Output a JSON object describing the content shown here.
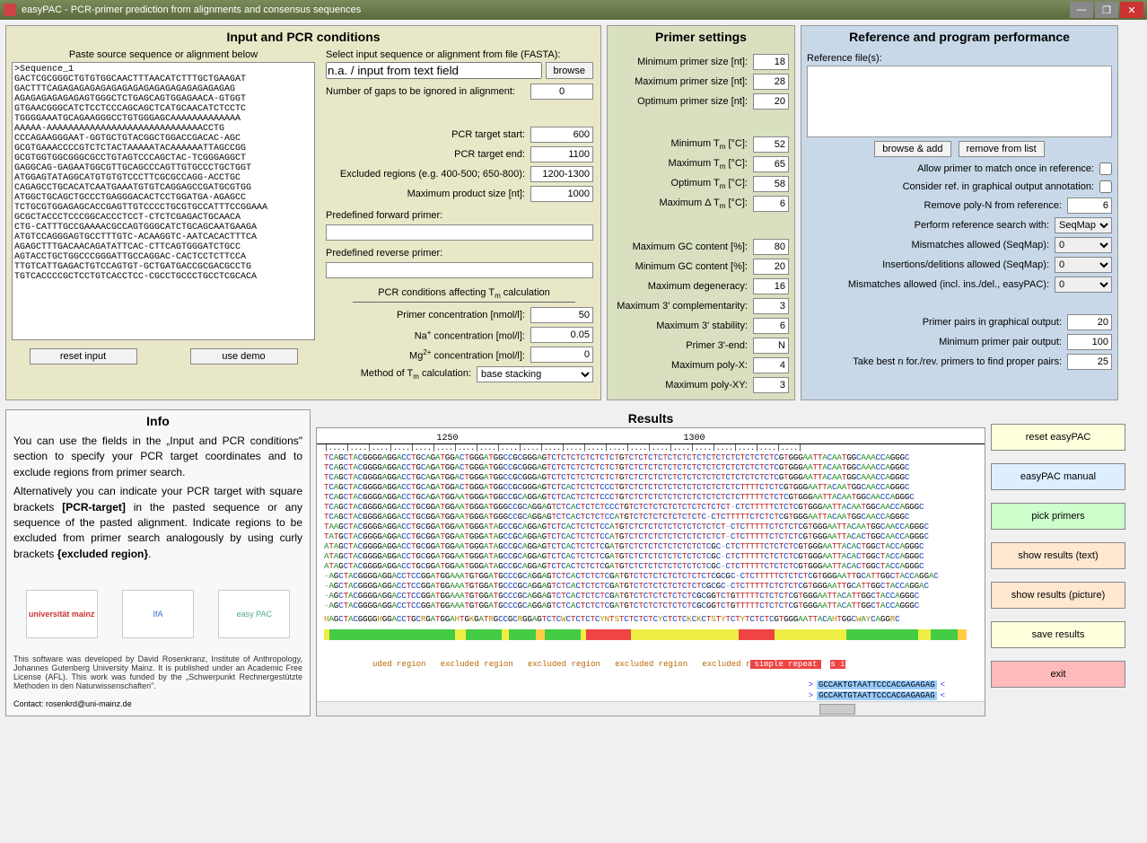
{
  "window": {
    "title": "easyPAC - PCR-primer prediction from alignments and consensus sequences"
  },
  "panels": {
    "input": {
      "title": "Input and PCR conditions"
    },
    "primer": {
      "title": "Primer settings"
    },
    "ref": {
      "title": "Reference and program performance"
    },
    "info": {
      "title": "Info"
    },
    "results": {
      "title": "Results"
    }
  },
  "input": {
    "paste_label": "Paste source sequence or alignment below",
    "sequence": ">Sequence_1\nGACTCGCGGGCTGTGTGGCAACTTTAACATCTTTGCTGAAGAT\nGACTTTCAGAGAGAGAGAGAGAGAGAGAGAGAGAGAGAGAG\nAGAGAGAGAGAGAGTGGGCTCTGAGCAGTGGAGAACA-GTGGT\nGTGAACGGGCATCTCCTCCCAGCAGCTCATGCAACATCTCCTC\nTGGGGAAATGCAGAAGGGCCTGTGGGAGCAAAAAAAAAAAAA\nAAAAA-AAAAAAAAAAAAAAAAAAAAAAAAAAAAACCTG\nCCCAGAAGGGAAT-GGTGCTGTACGGCTGGACCGACAC-AGC\nGCGTGAAACCCCGTCTCTACTAAAAATACAAAAAATTAGCCGG\nGCGTGGTGGCGGGCGCCTGTAGTCCCAGCTAC-TCGGGAGGCT\nGAGGCAG-GAGAATGGCGTTGCAGCCCAGTTGTGCCCTGCTGGT\nATGGAGTATAGGCATGTGTGTCCCTTCGCGCCAGG-ACCTGC\nCAGAGCCTGCACATCAATGAAATGTGTCAGGAGCCGATGCGTGG\nATGGCTGCAGCTGCCCTGAGGGACACTCCTGGATGA-AGAGCC\nTCTGCGTGGAGAGCACCGAGTTGTCCCCTGCGTGCCATTTCCGGAAA\nGCGCTACCCTCCCGGCACCCTCCT-CTCTCGAGACTGCAACA\nCTG-CATTTGCCGAAAACGCCAGTGGGCATCTGCAGCAATGAAGA\nATGTCCAGGGAGTGCCTTTGTC-ACAAGGTC-AATCACACTTTCA\nAGAGCTTTGACAACAGATATTCAC-CTTCAGTGGGATCTGCC\nAGTACCTGCTGGCCCGGGATTGCCAGGAC-CACTCCTCTTCCA\nTTGTCATTGAGACTGTCCAGTGT-GCTGATGACCGCGACGCCTG\nTGTCACCCCGCTCCTGTCACCTCC-CGCCTGCCCTGCCTCGCACA",
    "reset_btn": "reset input",
    "demo_btn": "use demo",
    "file_label": "Select input sequence or alignment from file (FASTA):",
    "file_value": "n.a. / input from text field",
    "browse_btn": "browse",
    "gaps_label": "Number of gaps to be ignored in alignment:",
    "gaps_value": "0",
    "target_start_label": "PCR target start:",
    "target_start_value": "600",
    "target_end_label": "PCR target end:",
    "target_end_value": "1100",
    "excluded_label": "Excluded regions (e.g. 400-500; 650-800):",
    "excluded_value": "1200-1300",
    "max_product_label": "Maximum product size [nt]:",
    "max_product_value": "1000",
    "pre_fwd_label": "Predefined forward primer:",
    "pre_rev_label": "Predefined reverse primer:",
    "tm_section": "PCR conditions affecting T_m calculation",
    "primer_conc_label": "Primer concentration [nmol/l]:",
    "primer_conc_value": "50",
    "na_conc_label": "Na+ concentration [mol/l]:",
    "na_conc_value": "0.05",
    "mg_conc_label": "Mg2+ concentration [mol/l]:",
    "mg_conc_value": "0",
    "tm_method_label": "Method of T_m calculation:",
    "tm_method_value": "base stacking"
  },
  "primer": {
    "min_size_label": "Minimum primer size [nt]:",
    "min_size_value": "18",
    "max_size_label": "Maximum primer size [nt]:",
    "max_size_value": "28",
    "opt_size_label": "Optimum primer size [nt]:",
    "opt_size_value": "20",
    "min_tm_label": "Minimum T_m [°C]:",
    "min_tm_value": "52",
    "max_tm_label": "Maximum T_m [°C]:",
    "max_tm_value": "65",
    "opt_tm_label": "Optimum T_m [°C]:",
    "opt_tm_value": "58",
    "delta_tm_label": "Maximum Δ T_m [°C]:",
    "delta_tm_value": "6",
    "max_gc_label": "Maximum GC content [%]:",
    "max_gc_value": "80",
    "min_gc_label": "Minimum GC content [%]:",
    "min_gc_value": "20",
    "max_deg_label": "Maximum degeneracy:",
    "max_deg_value": "16",
    "max_3comp_label": "Maximum 3' complementarity:",
    "max_3comp_value": "3",
    "max_3stab_label": "Maximum 3' stability:",
    "max_3stab_value": "6",
    "p3end_label": "Primer 3'-end:",
    "p3end_value": "N",
    "max_polyx_label": "Maximum poly-X:",
    "max_polyx_value": "4",
    "max_polyxy_label": "Maximum poly-XY:",
    "max_polyxy_value": "3"
  },
  "ref": {
    "files_label": "Reference file(s):",
    "browse_add": "browse & add",
    "remove": "remove from list",
    "allow_match_label": "Allow primer to match once in reference:",
    "consider_graph_label": "Consider ref. in graphical output annotation:",
    "remove_polyn_label": "Remove poly-N from reference:",
    "remove_polyn_value": "6",
    "search_with_label": "Perform reference search with:",
    "search_with_value": "SeqMap",
    "mm_seqmap_label": "Mismatches allowed (SeqMap):",
    "mm_seqmap_value": "0",
    "indel_seqmap_label": "Insertions/delitions allowed (SeqMap):",
    "indel_seqmap_value": "0",
    "mm_easypac_label": "Mismatches allowed (incl. ins./del., easyPAC):",
    "mm_easypac_value": "0",
    "pairs_graph_label": "Primer pairs in graphical output:",
    "pairs_graph_value": "20",
    "min_pair_out_label": "Minimum primer pair output:",
    "min_pair_out_value": "100",
    "best_n_label": "Take best n for./rev. primers to find proper pairs:",
    "best_n_value": "25"
  },
  "info": {
    "text1": "You can use the fields in the „Input and PCR conditions\" section to specify your PCR target coordinates and to exclude regions from primer search.",
    "text2a": "Alternatively you can indicate your PCR target with square brackets ",
    "text2b": "[PCR-target]",
    "text2c": " in the pasted sequence or any sequence of the pasted alignment. Indicate regions to be excluded from primer search analogously by using curly brackets ",
    "text2d": "{excluded region}",
    "text2e": ".",
    "credits": "This software was developed by David Rosenkranz, Institute of Anthropology, Johannes Gutenberg University Mainz. It is published under an Academic Free License (AFL). This work was funded by the „Schwerpunkt Rechnergestützte Methoden in den Naturwissenschaften\".",
    "contact": "Contact: rosenkrd@uni-mainz.de",
    "logo1": "universität mainz",
    "logo2": "IfA",
    "logo3": "easy PAC"
  },
  "results": {
    "ruler": [
      "1250",
      "1300"
    ],
    "seq_lines": [
      "TCAGCTACGGGGAGGACCTGCAGATGGACTGGGATGGCCGCGGGAGTCTCTCTCTCTCTCTGTCTCTCTCTCTCTCTCTCTCTCTCTCTCTCTCGTGGGAATTACAATGGCAAACCAGGGC",
      "TCAGCTACGGGGAGGACCTGCAGATGGACTGGGATGGCCGCGGGAGTCTCTCTCTCTCTCTGTCTCTCTCTCTCTCTCTCTCTCTCTCTCTCTCGTGGGAATTACAATGGCAAACCAGGGC",
      "TCAGCTACGGGGAGGACCTGCAGATGGACTGGGATGGCCGCGGGAGTCTCTCTCTCTCTCTGTCTCTCTCTCTCTCTCTCTCTCTCTCTCTCTCGTGGGAATTACAATGGCAAACCAGGGC",
      "TCAGCTACGGGGAGGACCTGCAGATGGACTGGGATGGCCGCGGGAGTCTCACTCTCTCCCTGTCTCTCTCTCTCTCTCTCTCTCTCTTTTCTCTCGTGGGAATTACAATGGCAACCAGGGC",
      "TCAGCTACGGGGAGGACCTGCAGATGGAATGGGATGGCCGCAGGAGTCTCACTCTCTCCCTGTCTCTCTCTCTCTCTCTCTCTCTCTTTTTCTCTCGTGGGAATTACAATGGCAACCAGGGC",
      "TCAGCTACGGGGAGGACCTGCGGATGGAATGGGATGGGCCGCAGGAGTCTCACTCTCTCCCTGTCTCTCTCTCTCTCTCTCTCT-CTCTTTTTCTCTCGTGGGAATTACAATGGCAACCAGGGC",
      "TCAGCTACGGGGAGGACCTGCGGATGGAATGGGATGGGCCGCAGGAGTCTCACTCTCTCCATGTCTCTCTCTCTCTCTC-CTCTTTTTCTCTCTCGTGGGAATTACAATGGCAACCAGGGC",
      "TAAGCTACGGGGAGGACCTGCGGATGGAATGGGATAGCCGCAGGAGTCTCACTCTCTCCATGTCTCTCTCTCTCTCTCTCTCT-CTCTTTTTCTCTCTCGTGGGAATTACAATGGCAACCAGGGC",
      "TATGCTACGGGGAGGACCTGCGGATGGAATGGGATAGCCGCAGGAGTCTCACTCTCTCCATGTCTCTCTCTCTCTCTCTCTCT-CTCTTTTTCTCTCTCGTGGGAATTACACTGGCAACCAGGGC",
      "ATAGCTACGGGGAGGACCTGCGGATGGAATGGGATAGCCGCAGGAGTCTCACTCTCTCGATGTCTCTCTCTCTCTCTCTCGC-CTCTTTTTCTCTCTCGTGGGAATTACACTGGCTACCAGGGC",
      "ATAGCTACGGGGAGGACCTGCGGATGGAATGGGATAGCCGCAGGAGTCTCACTCTCTCGATGTCTCTCTCTCTCTCTCTCGC-CTCTTTTTCTCTCTCGTGGGAATTACACTGGCTACCAGGGC",
      "ATAGCTACGGGGAGGACCTGCGGATGGAATGGGATAGCCGCAGGAGTCTCACTCTCTCGATGTCTCTCTCTCTCTCTCTCGC-CTCTTTTTCTCTCTCGTGGGAATTACACTGGCTACCAGGGC",
      "-AGCTACGGGGAGGACCTCCGGATGGAAATGTGGATGCCCGCAGGAGTCTCACTCTCTCGATGTCTCTCTCTCTCTCTCTCGCGC-CTCTTTTTCTCTCTCGTGGGAATTGCATTGGCTACCAGGAC",
      "-AGCTACGGGGAGGACCTCCGGATGGAAATGTGGATGCCCGCAGGAGTCTCACTCTCTCGATGTCTCTCTCTCTCTCTCGCGC-CTCTTTTTCTCTCTCGTGGGAATTGCATTGGCTACCAGGAC",
      "-AGCTACGGGGAGGACCTCCGGATGGAAATGTGGATGCCCGCAGGAGTCTCACTCTCTCGATGTCTCTCTCTCTCTCGCGGTCTGTTTTTCTCTCTCGTGGGAATTACATTGGCTACCAGGGC",
      "-AGCTACGGGGAGGACCTCCGGATGGAAATGTGGATGCCCGCAGGAGTCTCACTCTCTCGATGTCTCTCTCTCTCTCGCGGTCTGTTTTTCTCTCTCGTGGGAATTACATTGGCTACCAGGGC"
    ],
    "consensus": "HAGCTACGGGGHGGACCTGCRGATGGAHTGKGATRGCCGCRGGAGTCTCWCTCTCTCYNTSTCTCTCTCYCTCTCKCKCTSTYTCTYTCTCTCGTGGGAATTACAHTGGCWAYCAGGRC",
    "excluded_labels": [
      "uded region",
      "excluded region",
      "excluded region",
      "excluded region",
      "excluded r"
    ],
    "simple_repeat": "simple repeat",
    "si": "s i",
    "primer_seq": "GCCAKTGTAATTCCCACGAGAGAG"
  },
  "actions": {
    "reset": "reset easyPAC",
    "manual": "easyPAC manual",
    "pick": "pick primers",
    "show_text": "show results (text)",
    "show_pic": "show results (picture)",
    "save": "save results",
    "exit": "exit"
  }
}
